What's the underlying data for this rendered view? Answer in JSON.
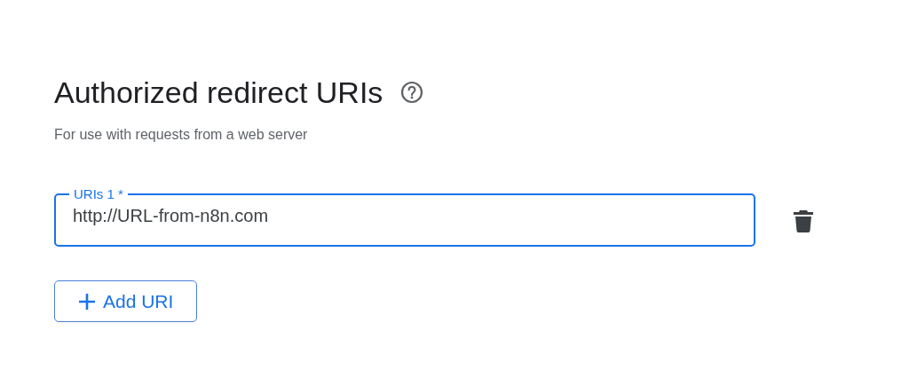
{
  "section": {
    "title": "Authorized redirect URIs",
    "description": "For use with requests from a web server"
  },
  "uris": [
    {
      "label": "URIs 1 *",
      "value": "http://URL-from-n8n.com",
      "focused": true
    }
  ],
  "add_button": {
    "label": "Add URI"
  }
}
